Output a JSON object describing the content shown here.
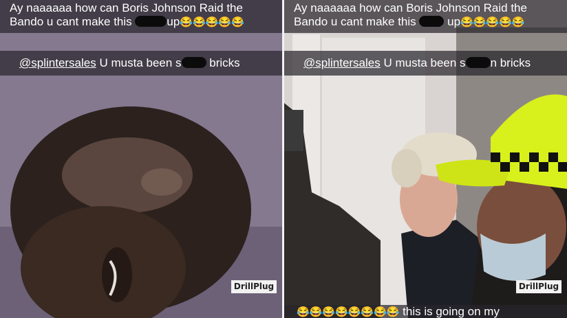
{
  "left_panel": {
    "caption_line1": "Ay naaaaaa how can Boris Johnson Raid the",
    "caption_line2_before": "Bando u cant make this",
    "caption_line2_after": "up",
    "caption_emojis": "😂😂😂😂😂",
    "reply_mention": "@splintersales",
    "reply_before": "U musta been s",
    "reply_after": "bricks",
    "watermark": "DrillPlug"
  },
  "right_panel": {
    "caption_line1": "Ay naaaaaa how can Boris Johnson Raid the",
    "caption_line2_before": "Bando u cant make this",
    "caption_line2_after": "up",
    "caption_emojis": "😂😂😂😂😂",
    "reply_mention": "@splintersales",
    "reply_before": "U musta been s",
    "reply_after": "n bricks",
    "watermark": "DrillPlug",
    "bottom_emojis": "😂😂😂😂😂😂😂😂",
    "bottom_text": "this is going on my"
  },
  "colors": {
    "caption_bar": "#28262c",
    "hi_vis_yellow": "#d8f01c",
    "watermark_bg": "#f2f2f2"
  }
}
